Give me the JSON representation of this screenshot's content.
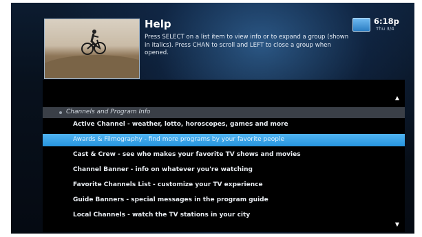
{
  "header": {
    "title": "Help",
    "description": "Press SELECT on a list item to view info or to expand a group (shown in italics). Press CHAN to scroll and LEFT to close a group when opened."
  },
  "clock": {
    "time": "6:18p",
    "date": "Thu 3/4"
  },
  "list": {
    "group_label": "Channels and Program Info",
    "items": [
      "Active Channel - weather, lotto, horoscopes, games and more",
      "Awards & Filmography - find more programs by your favorite people",
      "Cast & Crew - see who makes your favorite TV shows and movies",
      "Channel Banner - info on whatever you're watching",
      "Favorite Channels List - customize your TV experience",
      "Guide Banners - special messages in the program guide",
      "Local Channels - watch the TV stations in your city"
    ],
    "selected_index": 1
  },
  "colors": {
    "highlight": "#2f9fe6",
    "panel": "#000000"
  }
}
